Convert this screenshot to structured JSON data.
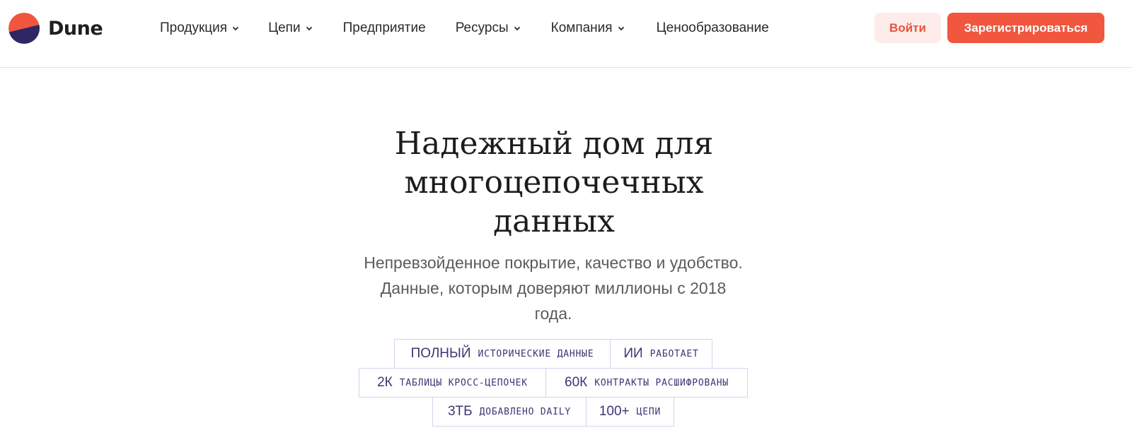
{
  "brand": {
    "name": "Dune",
    "colors": {
      "top": "#f0573e",
      "bottom": "#2d2766"
    }
  },
  "nav": {
    "items": [
      {
        "label": "Продукция",
        "has_dropdown": true
      },
      {
        "label": "Цепи",
        "has_dropdown": true
      },
      {
        "label": "Предприятие",
        "has_dropdown": false
      },
      {
        "label": "Ресурсы",
        "has_dropdown": true
      },
      {
        "label": "Компания",
        "has_dropdown": true
      },
      {
        "label": "Ценообразование",
        "has_dropdown": false
      }
    ],
    "login_label": "Войти",
    "register_label": "Зарегистрироваться"
  },
  "hero": {
    "title_lines": [
      "Надежный дом для",
      "многоцепочечных",
      "данных"
    ],
    "subtitle_lines": [
      "Непревзойденное покрытие, качество и удобство.",
      "Данные, которым доверяют миллионы с 2018",
      "года."
    ]
  },
  "stats": {
    "rows": [
      [
        {
          "value": "ПОЛНЫЙ",
          "label": "исторические данные"
        },
        {
          "value": "ИИ",
          "label": "работает"
        }
      ],
      [
        {
          "value": "2К",
          "label": "таблицы кросс-цепочек"
        },
        {
          "value": "60К",
          "label": "контракты расшифрованы"
        }
      ],
      [
        {
          "value": "3ТБ",
          "label": "добавлено daily"
        },
        {
          "value": "100+",
          "label": "цепи"
        }
      ]
    ]
  },
  "theme": {
    "accent": "#f0573e",
    "accent_soft": "#fdecea",
    "stat_text": "#3b3674",
    "stat_border": "#d6d2ea"
  }
}
